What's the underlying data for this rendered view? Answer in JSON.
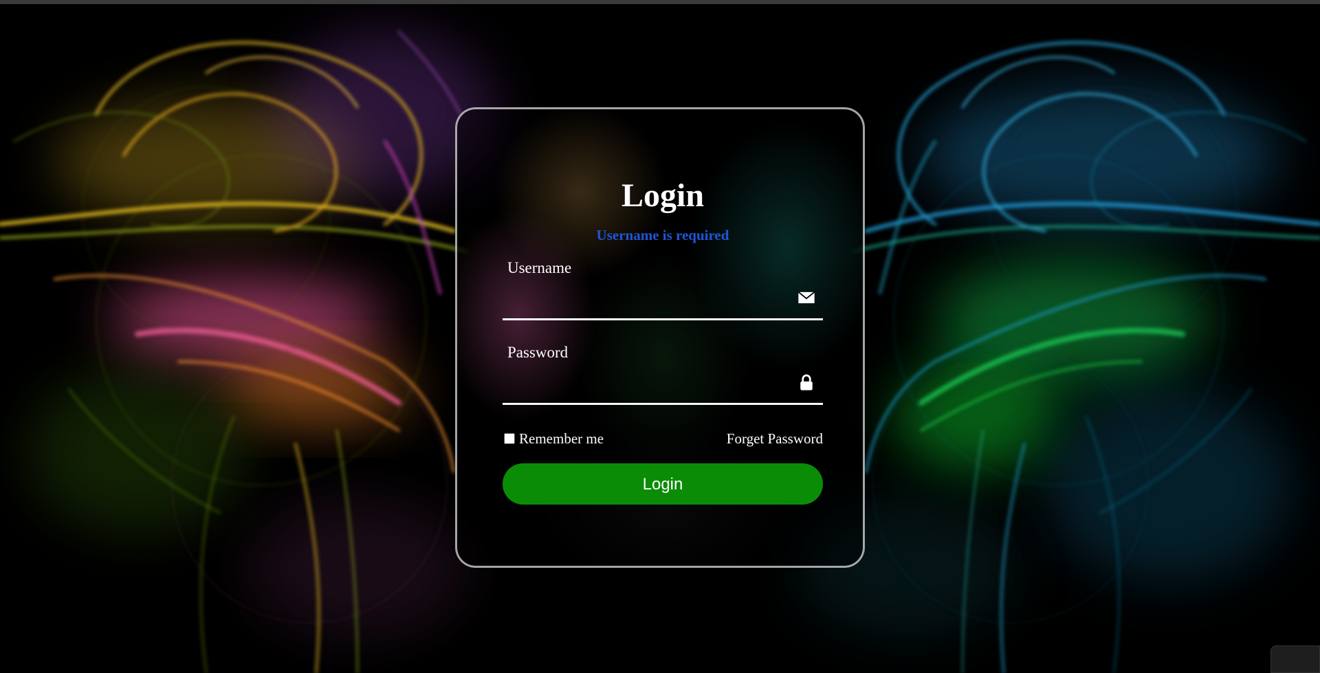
{
  "login_form": {
    "title": "Login",
    "error_message": "Username is required",
    "username": {
      "label": "Username",
      "value": "",
      "icon": "envelope-icon"
    },
    "password": {
      "label": "Password",
      "value": "",
      "icon": "lock-icon"
    },
    "remember_me": {
      "label": "Remember me",
      "checked": false
    },
    "forgot_password_label": "Forget Password",
    "submit_label": "Login"
  },
  "colors": {
    "submit_button": "#0b8c07",
    "error_text": "#1f56d6",
    "card_border": "#dcdcdc"
  }
}
